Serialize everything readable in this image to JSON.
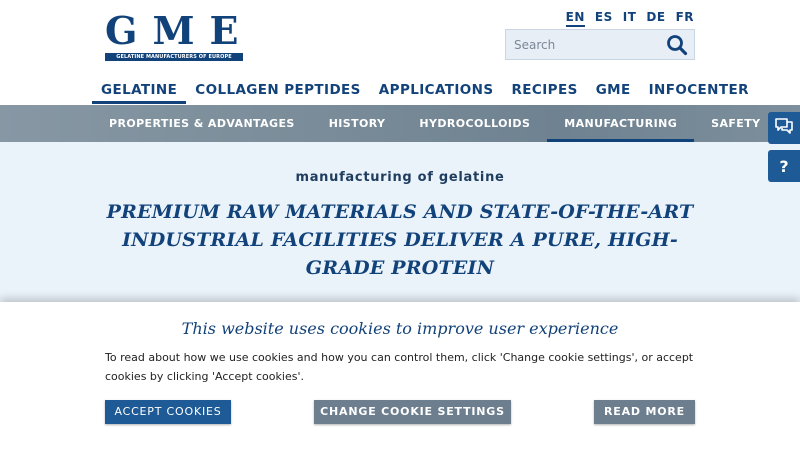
{
  "logo": {
    "text": "GME",
    "tagline": "GELATINE MANUFACTURERS OF EUROPE"
  },
  "languages": [
    {
      "code": "EN",
      "active": true
    },
    {
      "code": "ES",
      "active": false
    },
    {
      "code": "IT",
      "active": false
    },
    {
      "code": "DE",
      "active": false
    },
    {
      "code": "FR",
      "active": false
    }
  ],
  "search": {
    "placeholder": "Search",
    "icon": "search-icon"
  },
  "main_nav": [
    {
      "label": "GELATINE",
      "active": true
    },
    {
      "label": "COLLAGEN PEPTIDES",
      "active": false
    },
    {
      "label": "APPLICATIONS",
      "active": false
    },
    {
      "label": "RECIPES",
      "active": false
    },
    {
      "label": "GME",
      "active": false
    },
    {
      "label": "INFOCENTER",
      "active": false
    }
  ],
  "sub_nav": [
    {
      "label": "PROPERTIES & ADVANTAGES",
      "active": false
    },
    {
      "label": "HISTORY",
      "active": false
    },
    {
      "label": "HYDROCOLLOIDS",
      "active": false
    },
    {
      "label": "MANUFACTURING",
      "active": true
    },
    {
      "label": "SAFETY",
      "active": false
    }
  ],
  "hero": {
    "eyebrow": "manufacturing of gelatine",
    "headline": "PREMIUM RAW MATERIALS AND STATE-OF-THE-ART INDUSTRIAL FACILITIES DELIVER A PURE, HIGH-GRADE PROTEIN"
  },
  "side_buttons": {
    "chat_icon": "chat-icon",
    "help_label": "?"
  },
  "cookie": {
    "title": "This website uses cookies to improve user experience",
    "text": "To read about how we use cookies and how you can control them, click 'Change cookie settings', or accept cookies by clicking 'Accept cookies'.",
    "accept_label": "ACCEPT COOKIES",
    "settings_label": "CHANGE COOKIE SETTINGS",
    "more_label": "READ MORE"
  },
  "colors": {
    "brand": "#12427a",
    "accent": "#1d5a96",
    "subnav": "#7a8c99",
    "hero_bg": "#eaf2fa",
    "secondary_button": "#6d7e8e"
  }
}
